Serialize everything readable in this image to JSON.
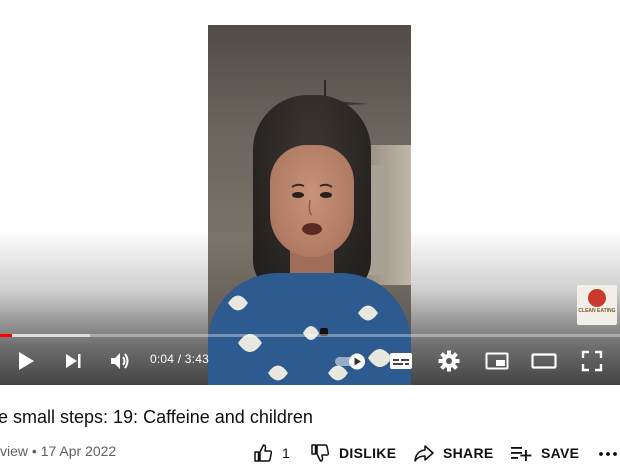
{
  "player": {
    "current_time": "0:04",
    "separator": "/",
    "duration": "3:43",
    "progress_played_fraction": 0.019,
    "progress_buffered_fraction": 0.145,
    "watermark_text": "CLEAN EATING",
    "accent_color": "#ff0000"
  },
  "video": {
    "title": "e small steps: 19: Caffeine and children",
    "views": "view",
    "dot": "•",
    "date": "17 Apr 2022"
  },
  "actions": {
    "like_count": "1",
    "dislike_label": "DISLIKE",
    "share_label": "SHARE",
    "save_label": "SAVE"
  },
  "icons": [
    "play-icon",
    "next-icon",
    "volume-icon",
    "autoplay-toggle-icon",
    "subtitles-icon",
    "settings-gear-icon",
    "miniplayer-icon",
    "theater-mode-icon",
    "fullscreen-icon",
    "thumbs-up-icon",
    "thumbs-down-icon",
    "share-icon",
    "save-playlist-icon",
    "more-icon"
  ]
}
